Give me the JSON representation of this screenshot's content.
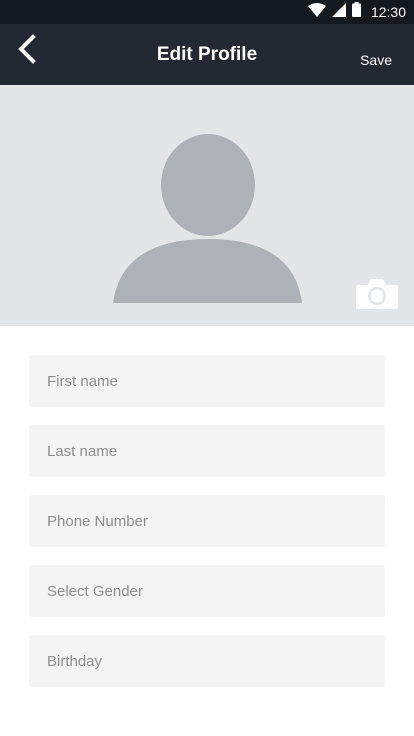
{
  "status_bar": {
    "time": "12:30"
  },
  "header": {
    "title": "Edit Profile",
    "save_label": "Save"
  },
  "form": {
    "first_name": {
      "value": "",
      "placeholder": "First name"
    },
    "last_name": {
      "value": "",
      "placeholder": "Last name"
    },
    "phone": {
      "value": "",
      "placeholder": "Phone Number"
    },
    "gender": {
      "value": "",
      "placeholder": "Select Gender"
    },
    "birthday": {
      "value": "",
      "placeholder": "Birthday"
    }
  },
  "icons": {
    "back": "chevron-left-icon",
    "camera": "camera-icon",
    "avatar": "user-placeholder-icon",
    "wifi": "wifi-icon",
    "signal": "signal-icon",
    "battery": "battery-icon"
  },
  "colors": {
    "status_bar": "#14181f",
    "app_bar": "#232833",
    "photo_background": "#e4e5e7",
    "avatar": "#aeb2b7",
    "field_background": "#f4f4f4",
    "placeholder_text": "#8e8e8e"
  }
}
